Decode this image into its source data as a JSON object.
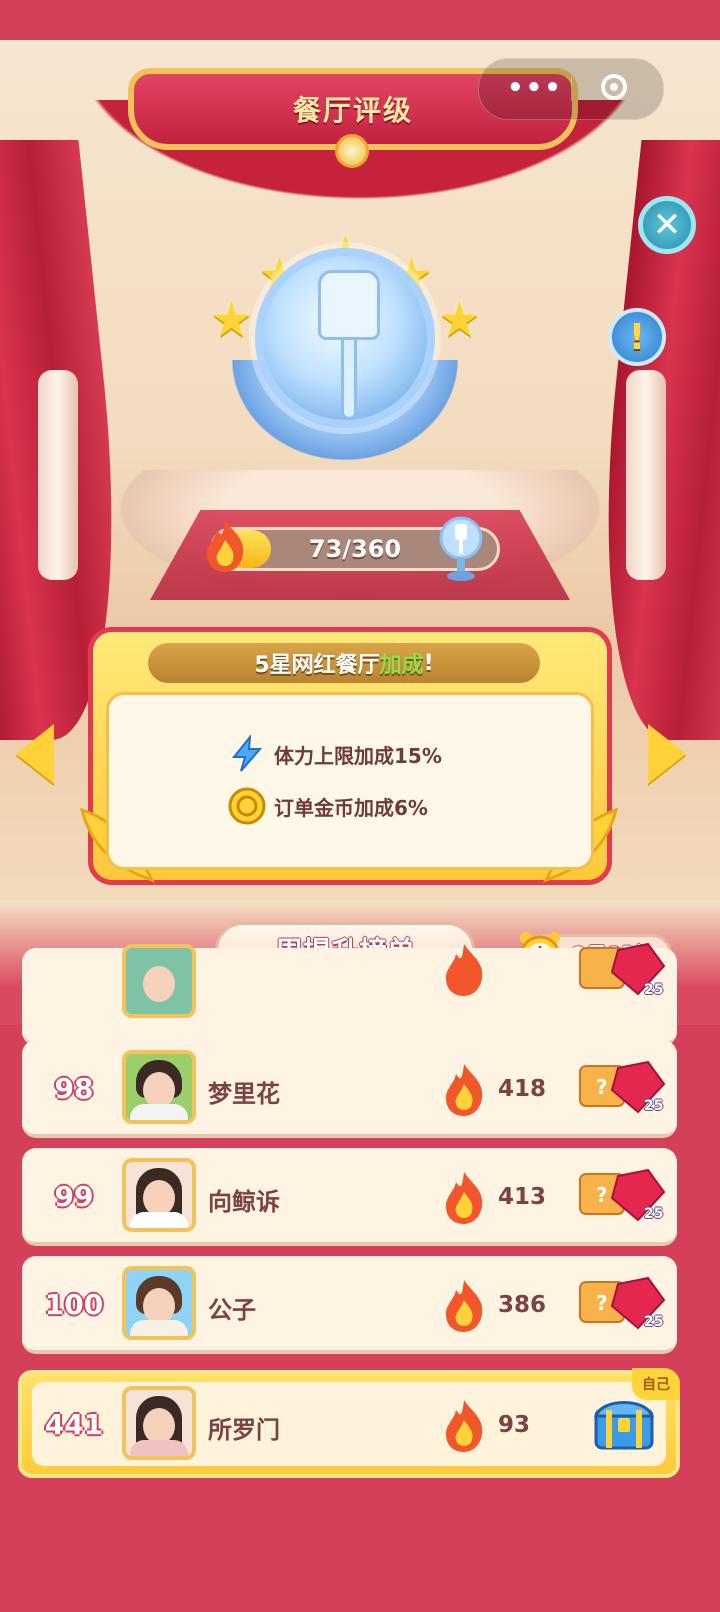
{
  "header": {
    "title": "餐厅评级",
    "capsule_menu": "•••",
    "rating_stars": 5
  },
  "progress": {
    "value": 73,
    "max": 360,
    "label": "73/360"
  },
  "bonus": {
    "title_prefix": "5星网红餐厅",
    "title_highlight": "加成",
    "title_suffix": "!",
    "items": [
      {
        "icon": "lightning-icon",
        "text": "体力上限加成15%"
      },
      {
        "icon": "gold-coin-icon",
        "text": "订单金币加成6%"
      }
    ]
  },
  "leaderboard": {
    "title": "周提升榜单",
    "timer": "2日2时",
    "partial_row": {
      "reward_count": "25"
    },
    "rows": [
      {
        "rank": "98",
        "name": "梦里花",
        "score": "418",
        "reward_count": "25"
      },
      {
        "rank": "99",
        "name": "向鲸诉",
        "score": "413",
        "reward_count": "25"
      },
      {
        "rank": "100",
        "name": "公子",
        "score": "386",
        "reward_count": "25"
      }
    ],
    "self": {
      "rank": "441",
      "name": "所罗门",
      "score": "93",
      "badge": "自己"
    }
  },
  "colors": {
    "background": "#d4405a",
    "accent_gold": "#ffd43b",
    "text_brown": "#7a4242",
    "bonus_green": "#8de04a"
  }
}
